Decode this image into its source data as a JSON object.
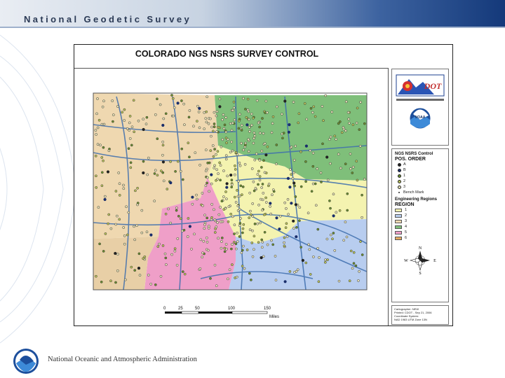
{
  "banner": {
    "title": "National Geodetic Survey"
  },
  "map": {
    "title": "COLORADO NGS NSRS SURVEY CONTROL",
    "logos": {
      "cdot_text": "DOT",
      "noaa_text": "NOAA"
    },
    "legend": {
      "title": "NGS NSRS Control",
      "order_heading": "POS. ORDER",
      "order_items": [
        {
          "label": "A",
          "color": "#222222"
        },
        {
          "label": "B",
          "color": "#1a2e6b"
        },
        {
          "label": "1",
          "color": "#6b8f2f"
        },
        {
          "label": "2",
          "color": "#b9c35a"
        },
        {
          "label": "3",
          "color": "#e8e4b8"
        },
        {
          "label": "Bench Mark",
          "color": "#333333"
        }
      ],
      "regions_title": "Engineering Regions",
      "region_heading": "REGION",
      "regions": [
        {
          "label": "1",
          "color": "#f4f3b0"
        },
        {
          "label": "2",
          "color": "#b8cdef"
        },
        {
          "label": "3",
          "color": "#efd8b0"
        },
        {
          "label": "4",
          "color": "#7fbf7a"
        },
        {
          "label": "5",
          "color": "#ef9fc8"
        },
        {
          "label": "6",
          "color": "#e2a860"
        }
      ]
    },
    "compass": {
      "n": "N",
      "s": "S",
      "e": "E",
      "w": "W"
    },
    "scale": {
      "ticks": [
        "0",
        "25",
        "50",
        "100",
        "150"
      ],
      "unit": "Miles"
    },
    "credits": [
      "Cartographer: NEW",
      "Printed: CDOT - Sep 21, 2006",
      "Coordinate System:",
      "NAD 1983 UTM Zone 13N"
    ]
  },
  "footer": {
    "agency": "National Oceanic and Atmospheric Administration"
  }
}
